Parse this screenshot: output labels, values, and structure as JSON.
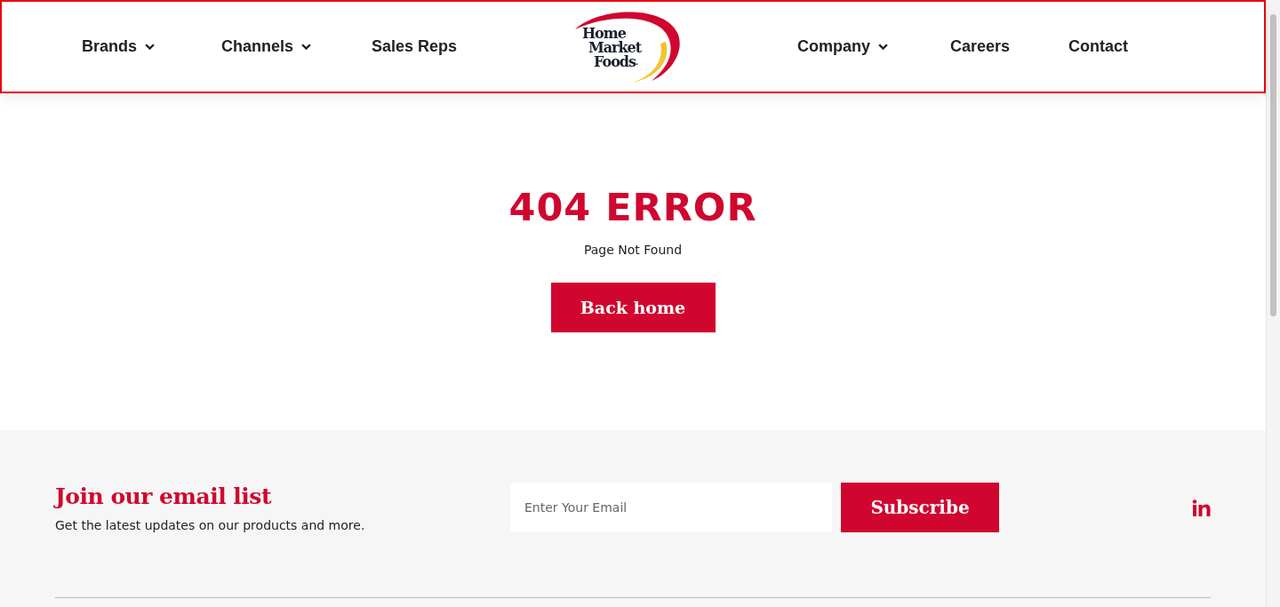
{
  "header": {
    "nav_left": [
      {
        "label": "Brands",
        "dropdown": true
      },
      {
        "label": "Channels",
        "dropdown": true
      },
      {
        "label": "Sales Reps",
        "dropdown": false
      }
    ],
    "logo": {
      "lines": [
        "Home",
        "Market",
        "Foods"
      ],
      "mark": "·"
    },
    "nav_right": [
      {
        "label": "Company",
        "dropdown": true
      },
      {
        "label": "Careers",
        "dropdown": false
      },
      {
        "label": "Contact",
        "dropdown": false
      }
    ]
  },
  "error": {
    "title": "404 ERROR",
    "message": "Page Not Found",
    "button": "Back home"
  },
  "footer": {
    "heading": "Join our email list",
    "text": "Get the latest updates on our products and more.",
    "email": {
      "placeholder": "Enter Your Email"
    },
    "subscribe": "Subscribe",
    "social": [
      {
        "kind": "linkedin"
      }
    ]
  }
}
